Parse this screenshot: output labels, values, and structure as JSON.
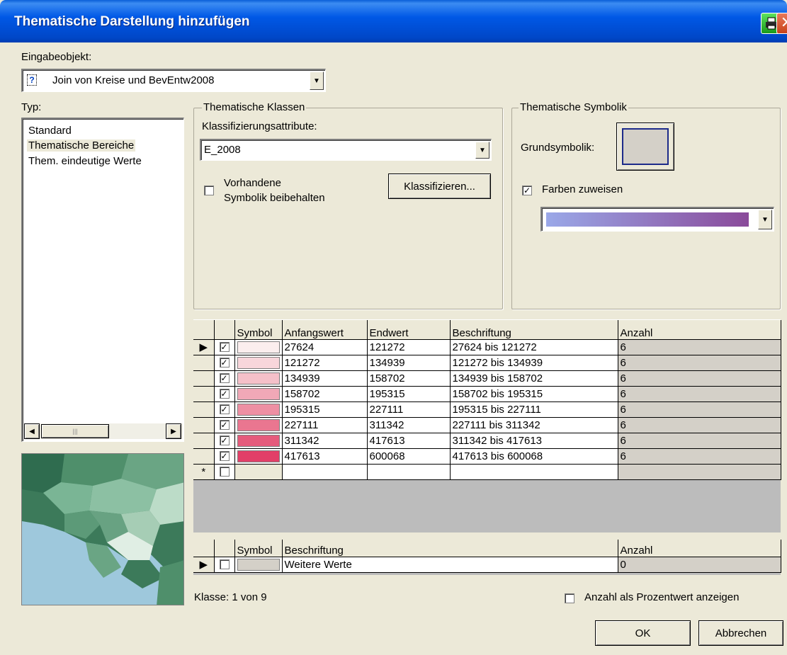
{
  "window": {
    "title": "Thematische Darstellung hinzufügen"
  },
  "input_object": {
    "label": "Eingabeobjekt:",
    "value": "Join von  Kreise und  BevEntw2008",
    "icon": "unknown-object-icon"
  },
  "type": {
    "label": "Typ:",
    "items": [
      "Standard",
      "Thematische Bereiche",
      "Them. eindeutige Werte"
    ],
    "selected_index": 1
  },
  "classes": {
    "group_label": "Thematische Klassen",
    "attr_label": "Klassifizierungsattribute:",
    "attr_value": "E_2008",
    "keep_label_line1": "Vorhandene",
    "keep_label_line2": "Symbolik beibehalten",
    "keep_checked": false,
    "classify_button": "Klassifizieren..."
  },
  "symbolik": {
    "group_label": "Thematische Symbolik",
    "base_label": "Grundsymbolik:",
    "assign_colors_label": "Farben zuweisen",
    "assign_colors_checked": true,
    "ramp_start": "#9aa8e8",
    "ramp_end": "#8a4a9a"
  },
  "class_table": {
    "headers": [
      "Symbol",
      "Anfangswert",
      "Endwert",
      "Beschriftung",
      "Anzahl"
    ],
    "rows": [
      {
        "checked": true,
        "color": "#fbeeee",
        "start": "27624",
        "end": "121272",
        "label": "27624 bis 121272",
        "count": "6"
      },
      {
        "checked": true,
        "color": "#f8d6db",
        "start": "121272",
        "end": "134939",
        "label": "121272 bis 134939",
        "count": "6"
      },
      {
        "checked": true,
        "color": "#f5c0c9",
        "start": "134939",
        "end": "158702",
        "label": "134939 bis 158702",
        "count": "6"
      },
      {
        "checked": true,
        "color": "#f1a8b7",
        "start": "158702",
        "end": "195315",
        "label": "158702 bis 195315",
        "count": "6"
      },
      {
        "checked": true,
        "color": "#ee8fa3",
        "start": "195315",
        "end": "227111",
        "label": "195315 bis 227111",
        "count": "6"
      },
      {
        "checked": true,
        "color": "#ea7690",
        "start": "227111",
        "end": "311342",
        "label": "227111 bis 311342",
        "count": "6"
      },
      {
        "checked": true,
        "color": "#e55b7c",
        "start": "311342",
        "end": "417613",
        "label": "311342 bis 417613",
        "count": "6"
      },
      {
        "checked": true,
        "color": "#e23f68",
        "start": "417613",
        "end": "600068",
        "label": "417613 bis 600068",
        "count": "6"
      }
    ],
    "new_row_marker": "*",
    "current_row_marker": "▶"
  },
  "other_table": {
    "headers": [
      "Symbol",
      "Beschriftung",
      "Anzahl"
    ],
    "row": {
      "checked": false,
      "color": "#d4d0c8",
      "label": "Weitere Werte",
      "count": "0"
    }
  },
  "status": {
    "class_text": "Klasse: 1 von 9"
  },
  "percent": {
    "label": "Anzahl als Prozentwert anzeigen",
    "checked": false
  },
  "buttons": {
    "ok": "OK",
    "cancel": "Abbrechen"
  }
}
